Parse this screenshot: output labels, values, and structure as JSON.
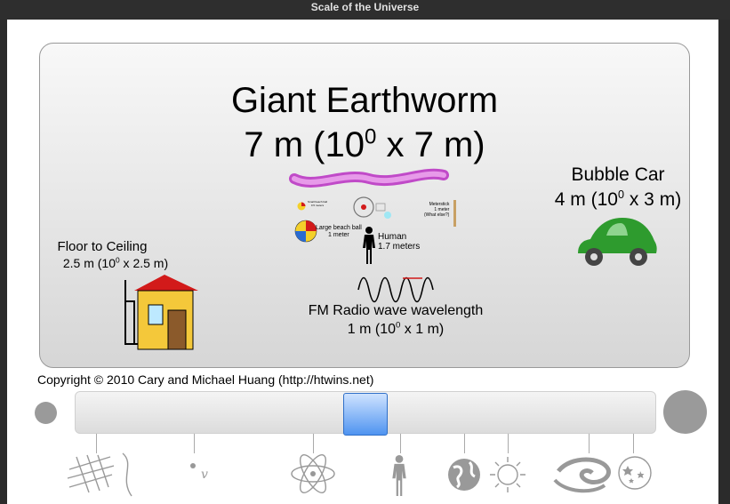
{
  "window": {
    "title": "Scale of the Universe"
  },
  "main_item": {
    "name": "Giant Earthworm",
    "size_prefix": "7 m (10",
    "exponent": "0",
    "size_suffix": " x 7 m)"
  },
  "objects": {
    "bubble_car": {
      "name": "Bubble Car",
      "size_prefix": "4 m (10",
      "exponent": "0",
      "size_suffix": " x 3 m)"
    },
    "floor_to_ceiling": {
      "name": "Floor to Ceiling",
      "size_prefix": "2.5 m (10",
      "exponent": "0",
      "size_suffix": " x 2.5 m)"
    },
    "fm_radio": {
      "name": "FM Radio wave wavelength",
      "size_prefix": "1 m (10",
      "exponent": "0",
      "size_suffix": " x 1 m)"
    },
    "human": {
      "name": "Human",
      "size": "1.7 meters"
    },
    "beach_ball": {
      "name": "Large beach ball",
      "size": "1 meter"
    },
    "small_beach_ball": {
      "name": "Small beach ball",
      "size": "0.5 meters"
    },
    "meterstick": {
      "name": "Meterstick",
      "size": "1 meter",
      "note": "(What else?)"
    }
  },
  "footer": {
    "copyright": "Copyright © 2010 Cary and Michael Huang (http://htwins.net)"
  },
  "slider": {
    "position": 0.5
  },
  "colors": {
    "worm": "#d16bd6",
    "car": "#2e9b2e",
    "house_roof": "#d21a1a",
    "house_wall": "#f4c83a",
    "thumb": "#4f94f0"
  }
}
